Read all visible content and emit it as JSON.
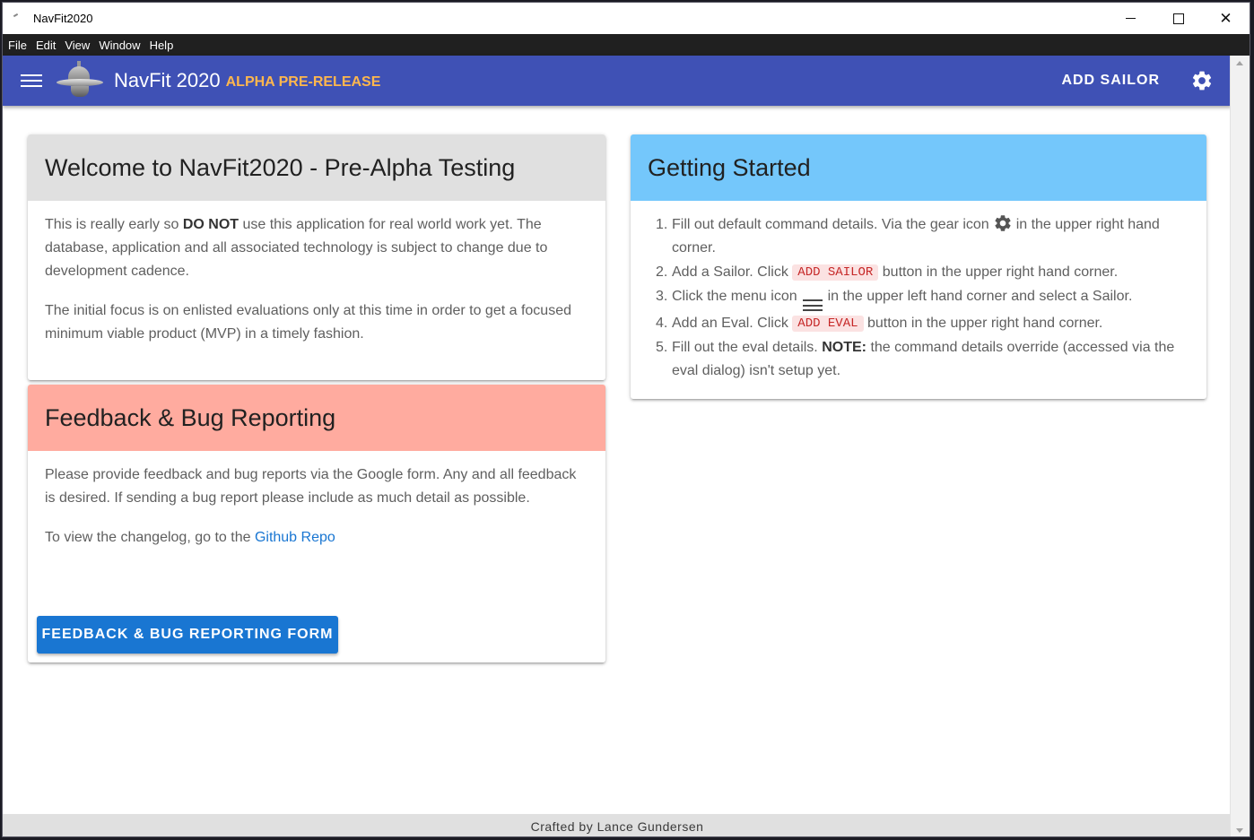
{
  "window": {
    "title": "NavFit2020"
  },
  "menubar": {
    "items": [
      "File",
      "Edit",
      "View",
      "Window",
      "Help"
    ]
  },
  "appbar": {
    "brand": "NavFit 2020",
    "subbrand": "ALPHA PRE-RELEASE",
    "add_sailor_label": "ADD SAILOR",
    "accent_color": "#3f51b5"
  },
  "welcome": {
    "title": "Welcome to NavFit2020 - Pre-Alpha Testing",
    "p1_before": "This is really early so ",
    "p1_bold": "DO NOT",
    "p1_after": " use this application for real world work yet. The database, application and all associated technology is subject to change due to development cadence.",
    "p2": "The initial focus is on enlisted evaluations only at this time in order to get a focused minimum viable product (MVP) in a timely fashion."
  },
  "feedback": {
    "title": "Feedback & Bug Reporting",
    "p1": "Please provide feedback and bug reports via the Google form. Any and all feedback is desired. If sending a bug report please include as much detail as possible.",
    "p2_before": "To view the changelog, go to the ",
    "link": "Github Repo",
    "button": "FEEDBACK & BUG REPORTING FORM"
  },
  "getting_started": {
    "title": "Getting Started",
    "s1_num": "1.",
    "s1_a": "Fill out default command details. Via the gear icon",
    "s1_b": "in the upper right hand corner.",
    "s2_num": "2.",
    "s2_a": "Add a Sailor. Click",
    "s2_chip": "ADD SAILOR",
    "s2_b": "button in the upper right hand corner.",
    "s3_num": "3.",
    "s3_a": "Click the menu icon",
    "s3_b": "in the upper left hand corner and select a Sailor.",
    "s4_num": "4.",
    "s4_a": "Add an Eval. Click",
    "s4_chip": "ADD EVAL",
    "s4_b": "button in the upper right hand corner.",
    "s5_num": "5.",
    "s5_a": "Fill out the eval details.",
    "s5_bold": "NOTE:",
    "s5_b": "the command details override (accessed via the eval dialog) isn't setup yet."
  },
  "footer": {
    "text": "Crafted by Lance Gundersen"
  }
}
